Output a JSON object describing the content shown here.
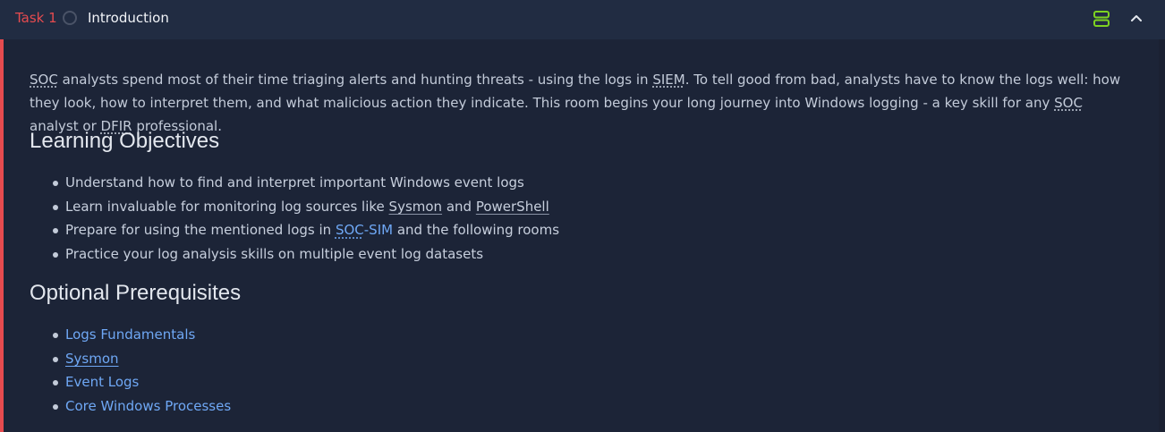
{
  "header": {
    "task_label": "Task 1",
    "title": "Introduction",
    "accent_color": "#e54b4f",
    "split_icon": "split-view-icon",
    "collapse_icon": "chevron-up-icon"
  },
  "intro": {
    "p1": "SOC",
    "p2": " analysts spend most of their time triaging alerts and hunting threats - using the logs in ",
    "p3": "SIEM",
    "p4": ". To tell good from bad, analysts have to know the logs well: how they look, how to interpret them, and what malicious action they indicate. This room begins your long journey into Windows logging - a key skill for any ",
    "p5": "SOC",
    "p6": " analyst or ",
    "p7": "DFIR",
    "p8": " professional."
  },
  "objectives": {
    "heading": "Learning Objectives",
    "item1": "Understand how to find and interpret important Windows event logs",
    "item2_pre": "Learn invaluable for monitoring log sources like ",
    "item2_sysmon": "Sysmon",
    "item2_and": " and ",
    "item2_ps": "PowerShell",
    "item3_pre": "Prepare for using the mentioned logs in ",
    "item3_soc": "SOC",
    "item3_dash": "-SIM",
    "item3_post": " and the following rooms",
    "item4": "Practice your log analysis skills on multiple event log datasets"
  },
  "prerequisites": {
    "heading": "Optional Prerequisites",
    "links": [
      "Logs Fundamentals",
      "Sysmon",
      "Event Logs",
      "Core Windows Processes"
    ]
  }
}
